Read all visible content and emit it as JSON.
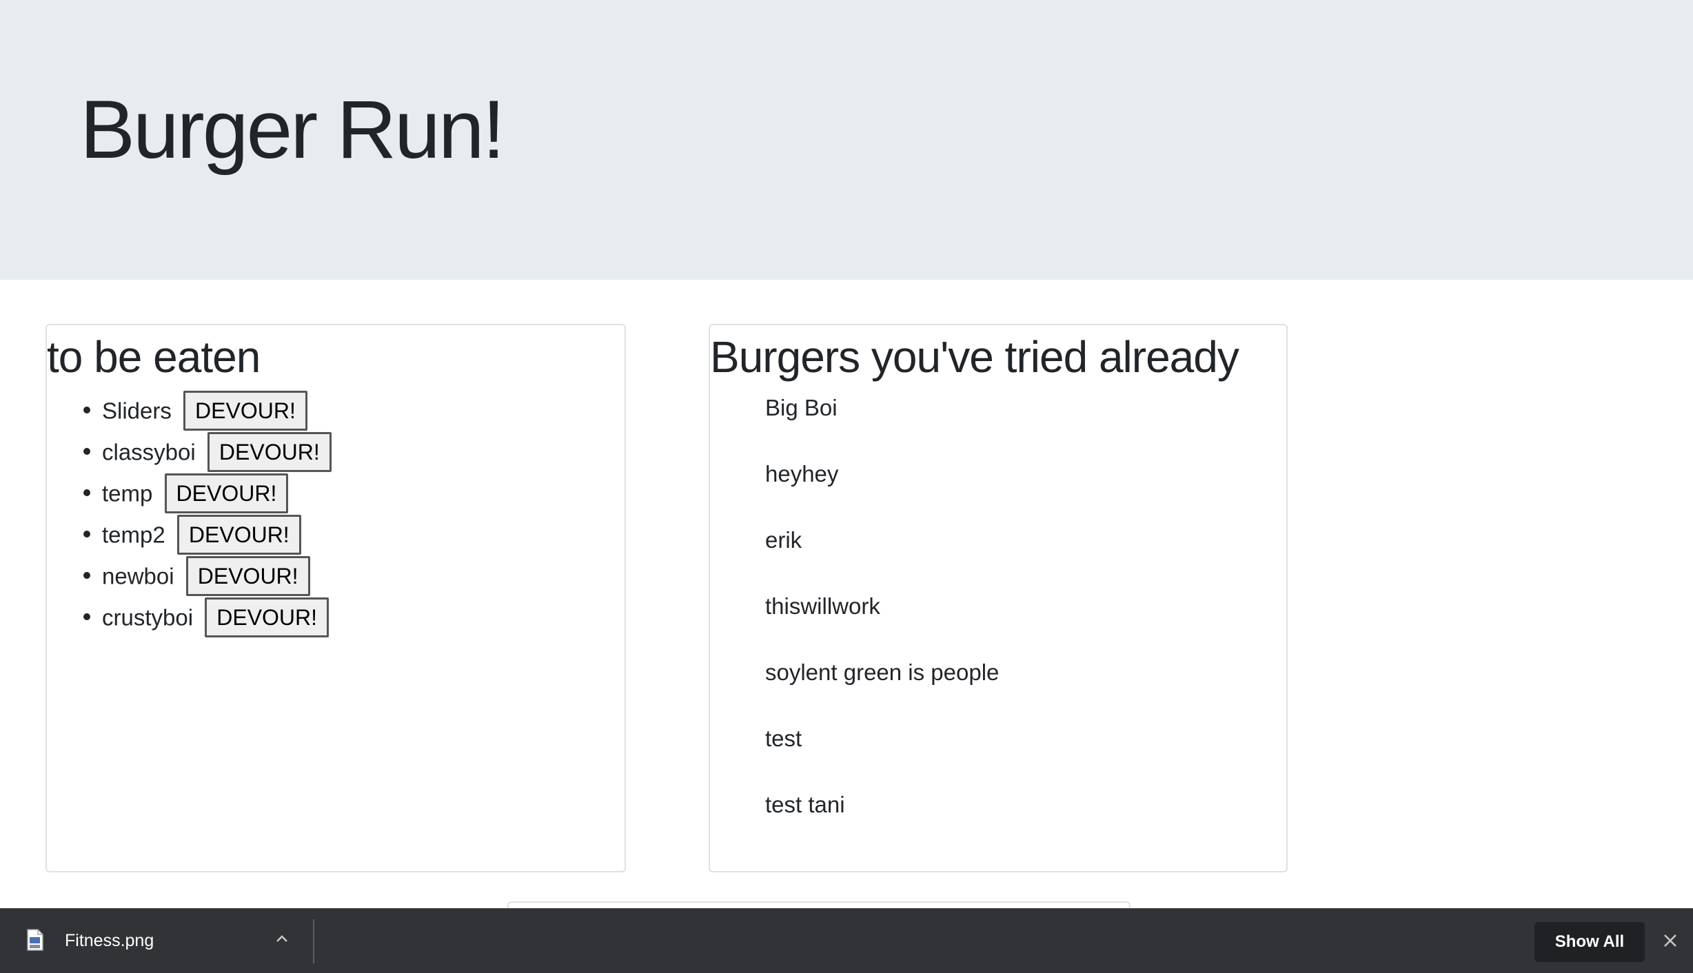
{
  "header": {
    "title": "Burger Run!"
  },
  "to_eat": {
    "heading": "to be eaten",
    "button_label": "DEVOUR!",
    "items": [
      {
        "name": "Sliders"
      },
      {
        "name": "classyboi"
      },
      {
        "name": "temp"
      },
      {
        "name": "temp2"
      },
      {
        "name": "newboi"
      },
      {
        "name": "crustyboi"
      }
    ]
  },
  "devoured": {
    "heading": "Burgers you've tried already",
    "items": [
      {
        "name": "Big Boi"
      },
      {
        "name": "heyhey"
      },
      {
        "name": "erik"
      },
      {
        "name": "thiswillwork"
      },
      {
        "name": "soylent green is people"
      },
      {
        "name": "test"
      },
      {
        "name": "test tani"
      }
    ]
  },
  "download_bar": {
    "file_name": "Fitness.png",
    "show_all_label": "Show All",
    "icons": {
      "file": "png-file-icon",
      "expand": "chevron-up-icon",
      "close": "close-icon"
    }
  },
  "colors": {
    "jumbotron_bg": "#e9ecef",
    "download_bar_bg": "#323337",
    "show_all_bg": "#202124"
  }
}
